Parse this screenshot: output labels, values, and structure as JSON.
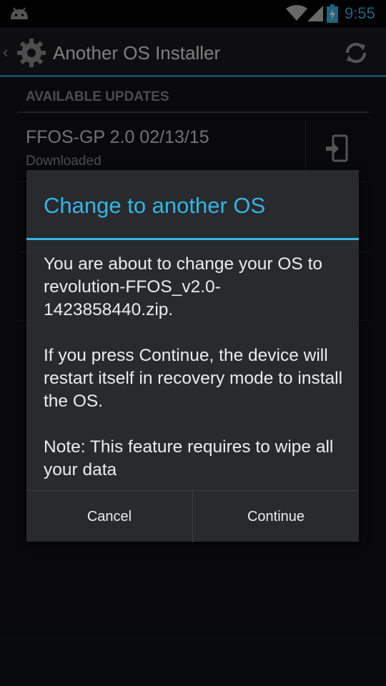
{
  "status_bar": {
    "time": "9:55",
    "icons": [
      "android-icon",
      "wifi-icon",
      "signal-icon",
      "battery-charging-icon"
    ]
  },
  "action_bar": {
    "title": "Another OS Installer",
    "icons": [
      "up-chevron-icon",
      "gear-logo-icon",
      "refresh-icon"
    ]
  },
  "list": {
    "section_header": "AVAILABLE UPDATES",
    "items": [
      {
        "title": "FFOS-GP 2.0 02/13/15",
        "status": "Downloaded",
        "action_icon": "install-device-icon"
      }
    ]
  },
  "dialog": {
    "title": "Change to another OS",
    "paragraphs": [
      "You are about to change your OS to revolution-FFOS_v2.0-1423858440.zip.",
      "If you press Continue, the device will restart itself in recovery mode to install the OS.",
      "Note: This feature requires to wipe all your data"
    ],
    "buttons": {
      "cancel": "Cancel",
      "continue": "Continue"
    }
  },
  "colors": {
    "accent": "#33b5e5",
    "background": "#111214",
    "dialog": "#282a2e"
  }
}
